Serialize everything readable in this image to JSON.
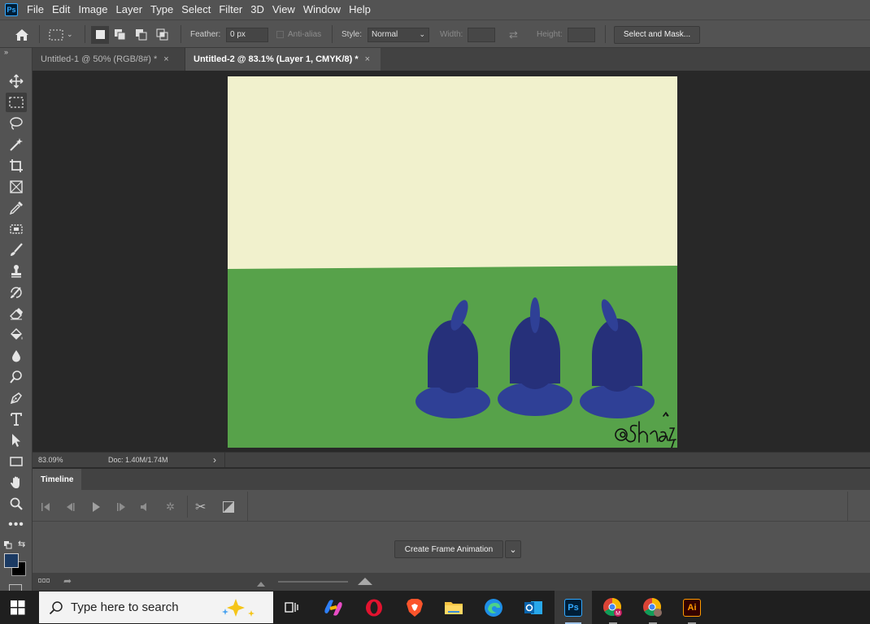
{
  "menubar": {
    "logo": "Ps",
    "items": [
      "File",
      "Edit",
      "Image",
      "Layer",
      "Type",
      "Select",
      "Filter",
      "3D",
      "View",
      "Window",
      "Help"
    ]
  },
  "options": {
    "feather_label": "Feather:",
    "feather_value": "0 px",
    "antialias_label": "Anti-alias",
    "style_label": "Style:",
    "style_value": "Normal",
    "width_label": "Width:",
    "height_label": "Height:",
    "select_mask_label": "Select and Mask..."
  },
  "tabs": [
    {
      "label": "Untitled-1 @ 50% (RGB/8#) *",
      "close": "×"
    },
    {
      "label": "Untitled-2 @ 83.1% (Layer 1, CMYK/8) *",
      "close": "×"
    }
  ],
  "canvas": {
    "sky_color": "#f1f1cd",
    "grass_color": "#57a24a",
    "figure_body_color": "#26307a",
    "figure_base_color": "#2f4096",
    "signature": "@Shazi"
  },
  "status": {
    "zoom": "83.09%",
    "doc": "Doc: 1.40M/1.74M",
    "arrow": "›"
  },
  "timeline": {
    "title": "Timeline",
    "create_button": "Create Frame Animation"
  },
  "taskbar": {
    "search_placeholder": "Type here to search",
    "photoshop_label": "Ps",
    "illustrator_label": "Ai"
  },
  "colors": {
    "foreground": "#1b3a63",
    "background": "#000000"
  }
}
